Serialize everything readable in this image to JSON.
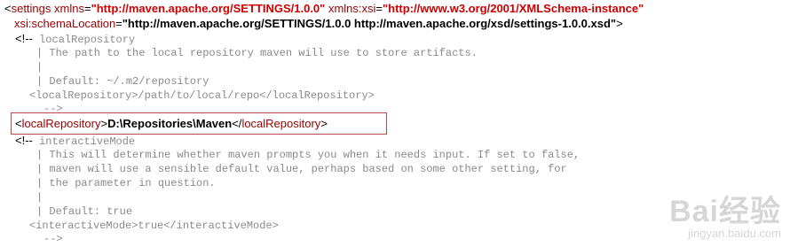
{
  "lines": {
    "l1": {
      "open": "<",
      "tag": "settings",
      "attr1": "xmlns",
      "eq1": "=",
      "val1": "\"http://maven.apache.org/SETTINGS/1.0.0\"",
      "attr2": "xmlns:xsi",
      "eq2": "=",
      "val2": "\"http://www.w3.org/2001/XMLSchema-instance\""
    },
    "l2": {
      "attr": "xsi:schemaLocation",
      "eq": "=",
      "val": "\"http://maven.apache.org/SETTINGS/1.0.0 http://maven.apache.org/xsd/settings-1.0.0.xsd\"",
      "close": ">"
    },
    "c1_open": "<!--",
    "c1_title": "localRepository",
    "c1_l2": "| The path to the local repository maven will use to store artifacts.",
    "c1_l3": "|",
    "c1_l4": "| Default: ~/.m2/repository",
    "c1_l5": "<localRepository>/path/to/local/repo</localRepository>",
    "c1_close": "-->",
    "hl": {
      "open_lt": "<",
      "open_tag": "localRepository",
      "open_gt": ">",
      "text": "D:\\Repositories\\Maven",
      "close_lt": "</",
      "close_tag": "localRepository",
      "close_gt": ">"
    },
    "c2_open": "<!--",
    "c2_title": "interactiveMode",
    "c2_l2": "| This will determine whether maven prompts you when it needs input. If set to false,",
    "c2_l3": "| maven will use a sensible default value, perhaps based on some other setting, for",
    "c2_l4": "| the parameter in question.",
    "c2_l5": "|",
    "c2_l6": "| Default: true",
    "c2_l7": "<interactiveMode>true</interactiveMode>",
    "c2_close": "-->"
  },
  "watermark": {
    "main": "Bai经验",
    "sub": "jingyan.baidu.com"
  }
}
